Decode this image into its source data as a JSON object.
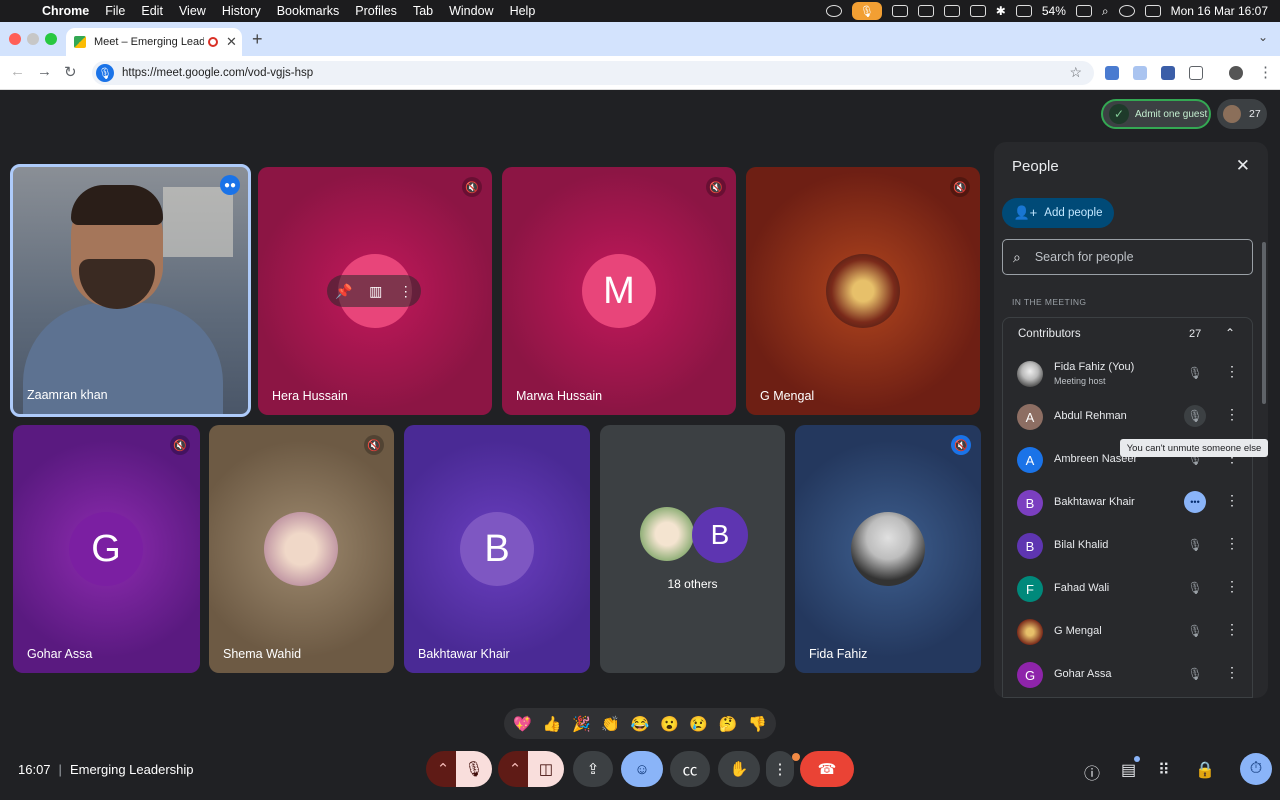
{
  "menubar": {
    "app": "Chrome",
    "items": [
      "File",
      "Edit",
      "View",
      "History",
      "Bookmarks",
      "Profiles",
      "Tab",
      "Window",
      "Help"
    ],
    "battery": "54%",
    "datetime": "Mon 16 Mar  16:07"
  },
  "browser": {
    "tab_title": "Meet – Emerging Leaders",
    "url": "https://meet.google.com/vod-vgjs-hsp"
  },
  "header": {
    "admit_label": "Admit one guest",
    "participant_count": "27"
  },
  "tiles": [
    {
      "name": "Zaamran khan"
    },
    {
      "name": "Hera Hussain"
    },
    {
      "name": "Marwa Hussain",
      "initial": "M"
    },
    {
      "name": "G Mengal"
    },
    {
      "name": "Gohar Assa",
      "initial": "G"
    },
    {
      "name": "Shema Wahid"
    },
    {
      "name": "Bakhtawar Khair",
      "initial": "B"
    },
    {
      "name": "18 others",
      "initial": "B"
    },
    {
      "name": "Fida Fahiz"
    }
  ],
  "reactions": [
    "💖",
    "👍",
    "🎉",
    "👏",
    "😂",
    "😮",
    "😢",
    "🤔",
    "👎"
  ],
  "footer": {
    "time": "16:07",
    "meeting_name": "Emerging Leadership"
  },
  "people_panel": {
    "title": "People",
    "add_people": "Add people",
    "search_placeholder": "Search for people",
    "section": "IN THE MEETING",
    "group": "Contributors",
    "group_count": "27",
    "people": [
      {
        "name": "Fida Fahiz (You)",
        "role": "Meeting host",
        "initial": "",
        "color": "#b0b0b0"
      },
      {
        "name": "Abdul Rehman",
        "initial": "A",
        "color": "#8d6e63"
      },
      {
        "name": "Ambreen Naseer",
        "initial": "A",
        "color": "#1a73e8"
      },
      {
        "name": "Bakhtawar Khair",
        "initial": "B",
        "color": "#7b3fc0"
      },
      {
        "name": "Bilal Khalid",
        "initial": "B",
        "color": "#5e35b1"
      },
      {
        "name": "Fahad Wali",
        "initial": "F",
        "color": "#00897b"
      },
      {
        "name": "G Mengal",
        "initial": "",
        "color": "#8a5a3a"
      },
      {
        "name": "Gohar Assa",
        "initial": "G",
        "color": "#8e24aa"
      }
    ],
    "tooltip": "You can't unmute someone else"
  }
}
